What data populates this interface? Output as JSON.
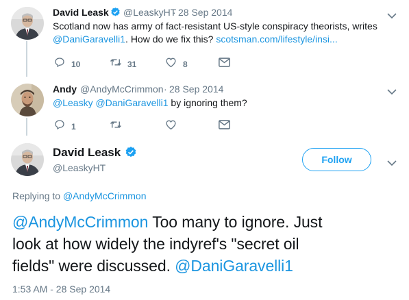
{
  "tweet1": {
    "name": "David Leask",
    "handle": "@LeaskyHT",
    "dot": "·",
    "date": "28 Sep 2014",
    "line1": "Scotland now has army of fact-resistant US-style conspiracy theorists, writes",
    "mention": "@DaniGaravelli1",
    "line2_text": ". How do we fix this?",
    "link": "scotsman.com/lifestyle/insi...",
    "replies": "10",
    "retweets": "31",
    "likes": "8"
  },
  "tweet2": {
    "name": "Andy",
    "handle": "@AndyMcCrimmon",
    "dot": "·",
    "date": "28 Sep 2014",
    "mention1": "@Leasky",
    "mention2": "@DaniGaravelli1",
    "text": "by ignoring them?",
    "replies": "1"
  },
  "main": {
    "name": "David Leask",
    "handle": "@LeaskyHT",
    "follow_label": "Follow",
    "replying_prefix": "Replying to",
    "replying_to": "@AndyMcCrimmon",
    "mention_start": "@AndyMcCrimmon",
    "text_1": "Too many to ignore. Just",
    "text_2": "look at how widely the indyref's \"secret oil",
    "text_3": "fields\" were discussed.",
    "mention_end": "@DaniGaravelli1",
    "timestamp": "1:53 AM - 28 Sep 2014"
  },
  "colors": {
    "link": "#1b95e0",
    "verified": "#1da1f2",
    "secondary": "#657786",
    "thread_line": "#ccd6dd"
  }
}
